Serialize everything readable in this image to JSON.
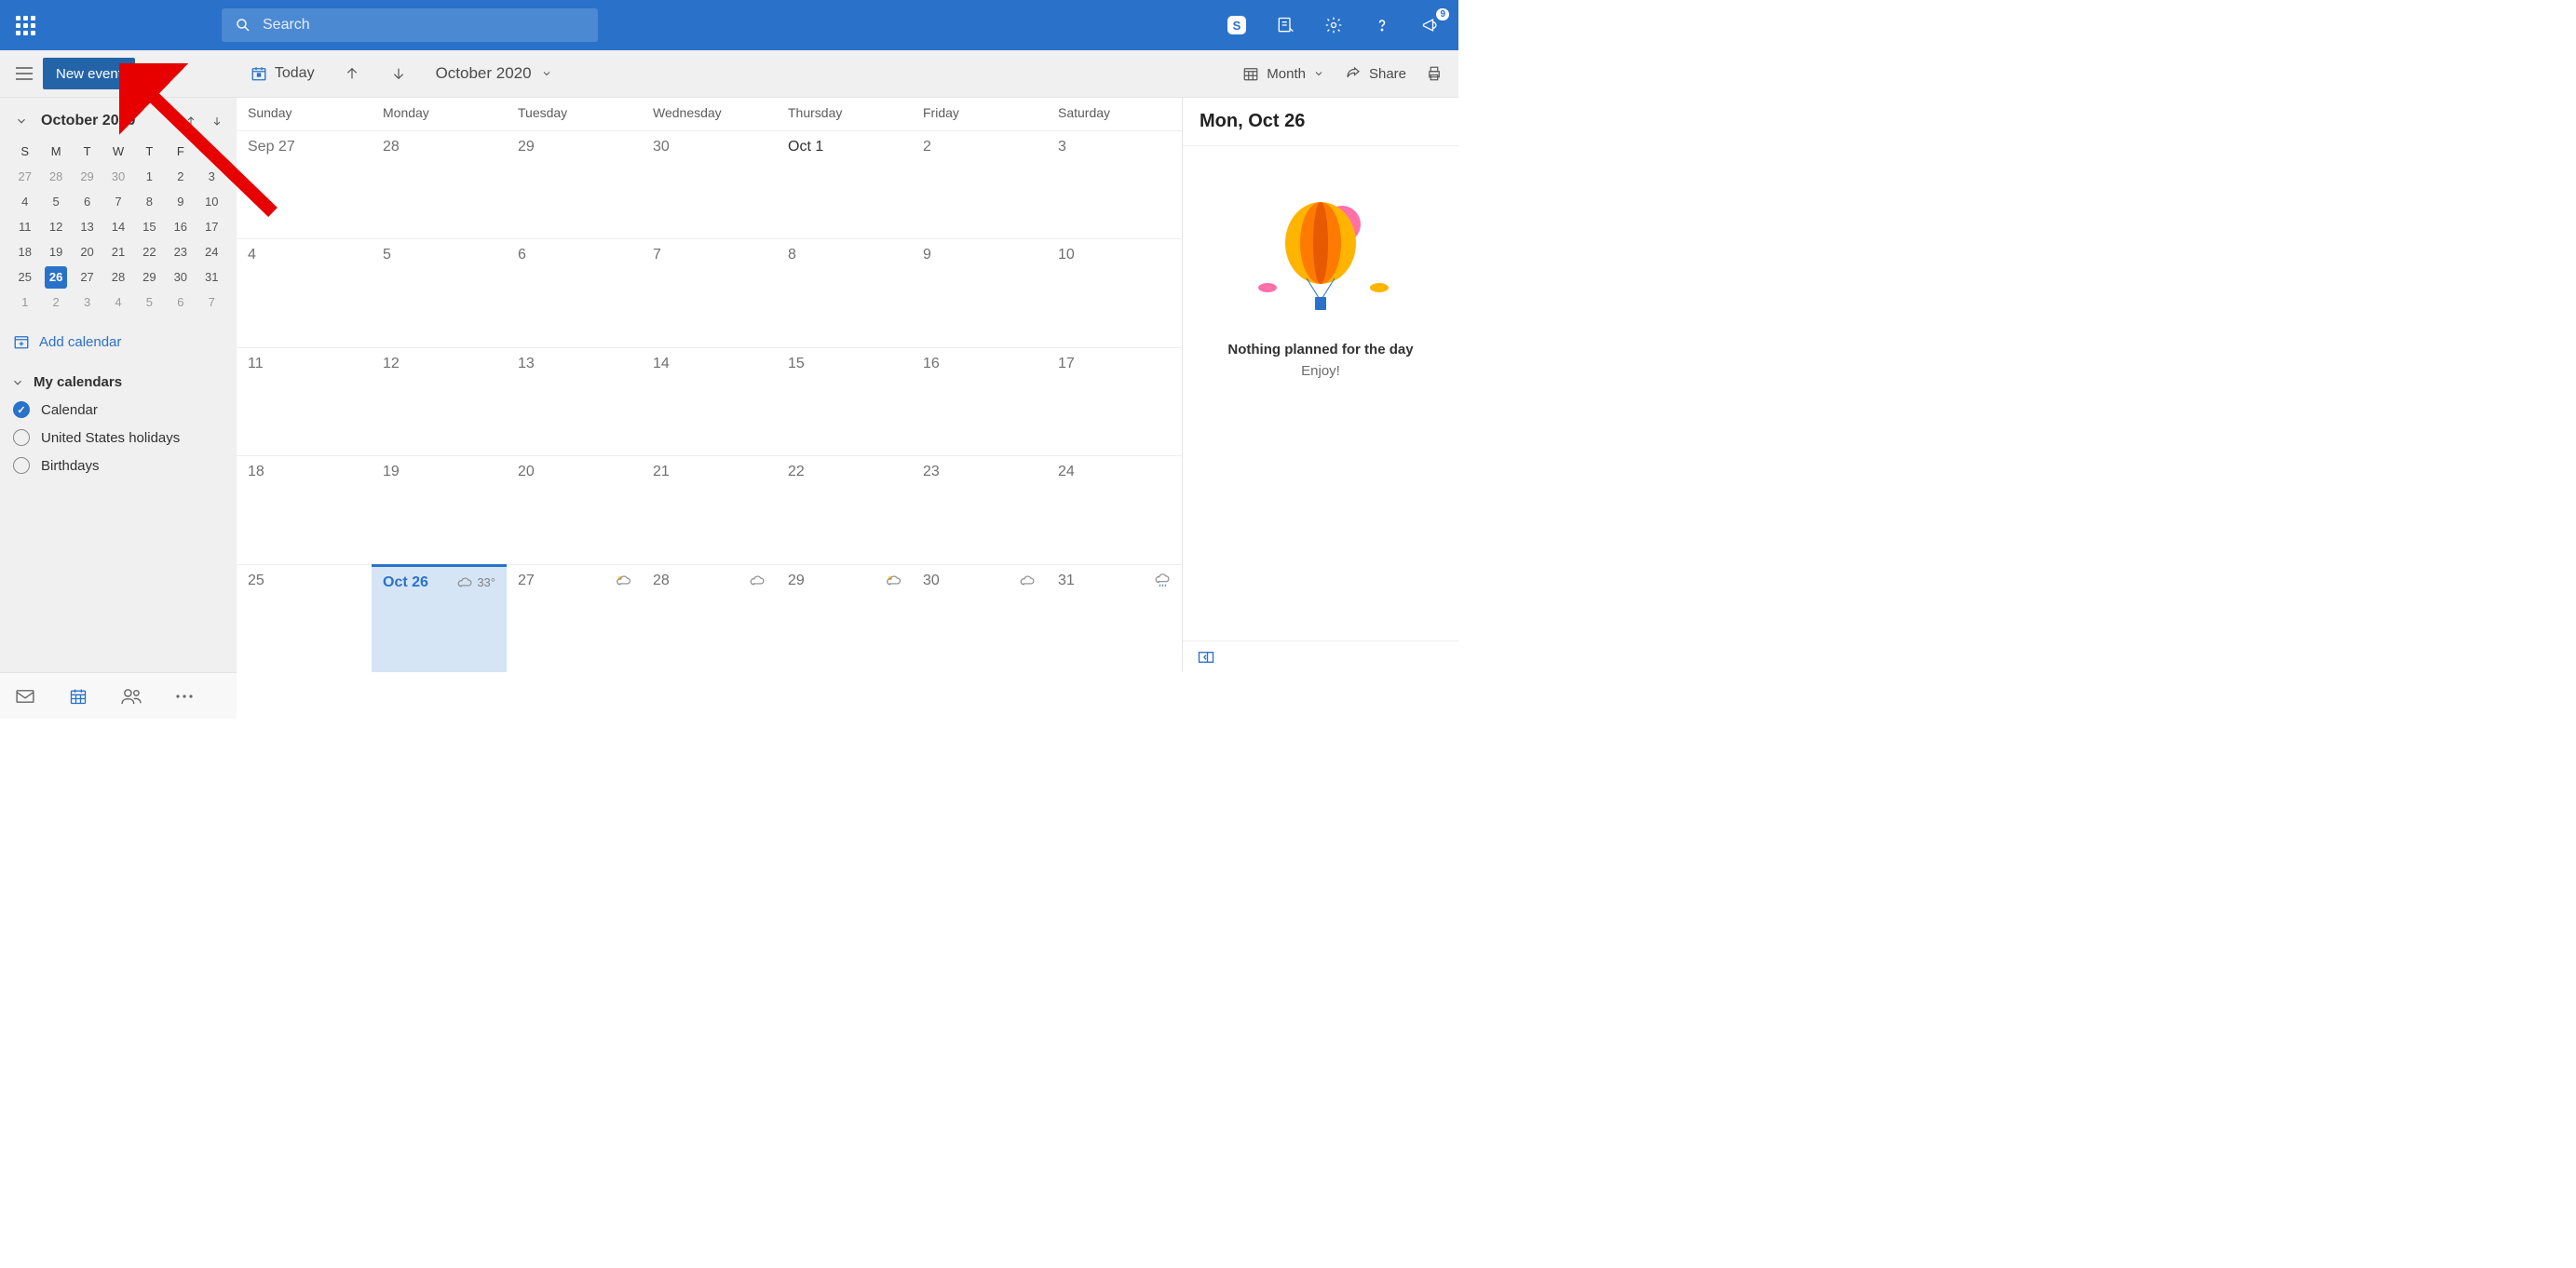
{
  "topbar": {
    "search_placeholder": "Search",
    "notification_count": "9",
    "skype_letter": "S"
  },
  "cmdbar": {
    "new_event": "New event",
    "today": "Today",
    "month_label": "October 2020",
    "view": "Month",
    "share": "Share"
  },
  "mini": {
    "title": "October 2020",
    "dow": [
      "S",
      "M",
      "T",
      "W",
      "T",
      "F",
      "S"
    ],
    "rows": [
      [
        {
          "d": "27",
          "dim": true
        },
        {
          "d": "28",
          "dim": true
        },
        {
          "d": "29",
          "dim": true
        },
        {
          "d": "30",
          "dim": true
        },
        {
          "d": "1"
        },
        {
          "d": "2"
        },
        {
          "d": "3"
        }
      ],
      [
        {
          "d": "4"
        },
        {
          "d": "5"
        },
        {
          "d": "6"
        },
        {
          "d": "7"
        },
        {
          "d": "8"
        },
        {
          "d": "9"
        },
        {
          "d": "10"
        }
      ],
      [
        {
          "d": "11"
        },
        {
          "d": "12"
        },
        {
          "d": "13"
        },
        {
          "d": "14"
        },
        {
          "d": "15"
        },
        {
          "d": "16"
        },
        {
          "d": "17"
        }
      ],
      [
        {
          "d": "18"
        },
        {
          "d": "19"
        },
        {
          "d": "20"
        },
        {
          "d": "21"
        },
        {
          "d": "22"
        },
        {
          "d": "23"
        },
        {
          "d": "24"
        }
      ],
      [
        {
          "d": "25"
        },
        {
          "d": "26",
          "today": true
        },
        {
          "d": "27"
        },
        {
          "d": "28"
        },
        {
          "d": "29"
        },
        {
          "d": "30"
        },
        {
          "d": "31"
        }
      ],
      [
        {
          "d": "1",
          "dim": true
        },
        {
          "d": "2",
          "dim": true
        },
        {
          "d": "3",
          "dim": true
        },
        {
          "d": "4",
          "dim": true
        },
        {
          "d": "5",
          "dim": true
        },
        {
          "d": "6",
          "dim": true
        },
        {
          "d": "7",
          "dim": true
        }
      ]
    ]
  },
  "add_calendar": "Add calendar",
  "my_calendars": "My calendars",
  "calendars": [
    {
      "name": "Calendar",
      "checked": true
    },
    {
      "name": "United States holidays",
      "checked": false
    },
    {
      "name": "Birthdays",
      "checked": false
    }
  ],
  "bigcal": {
    "dow": [
      "Sunday",
      "Monday",
      "Tuesday",
      "Wednesday",
      "Thursday",
      "Friday",
      "Saturday"
    ],
    "weeks": [
      [
        {
          "lbl": "Sep 27"
        },
        {
          "lbl": "28"
        },
        {
          "lbl": "29"
        },
        {
          "lbl": "30"
        },
        {
          "lbl": "Oct 1",
          "ms": true
        },
        {
          "lbl": "2"
        },
        {
          "lbl": "3"
        }
      ],
      [
        {
          "lbl": "4"
        },
        {
          "lbl": "5"
        },
        {
          "lbl": "6"
        },
        {
          "lbl": "7"
        },
        {
          "lbl": "8"
        },
        {
          "lbl": "9"
        },
        {
          "lbl": "10"
        }
      ],
      [
        {
          "lbl": "11"
        },
        {
          "lbl": "12"
        },
        {
          "lbl": "13"
        },
        {
          "lbl": "14"
        },
        {
          "lbl": "15"
        },
        {
          "lbl": "16"
        },
        {
          "lbl": "17"
        }
      ],
      [
        {
          "lbl": "18"
        },
        {
          "lbl": "19"
        },
        {
          "lbl": "20"
        },
        {
          "lbl": "21"
        },
        {
          "lbl": "22"
        },
        {
          "lbl": "23"
        },
        {
          "lbl": "24"
        }
      ],
      [
        {
          "lbl": "25"
        },
        {
          "lbl": "Oct 26",
          "today": true,
          "w": "33°",
          "wi": "cloud"
        },
        {
          "lbl": "27",
          "wi": "partly"
        },
        {
          "lbl": "28",
          "wi": "cloud"
        },
        {
          "lbl": "29",
          "wi": "partly"
        },
        {
          "lbl": "30",
          "wi": "cloud"
        },
        {
          "lbl": "31",
          "wi": "rain"
        }
      ]
    ]
  },
  "rightpane": {
    "title": "Mon, Oct 26",
    "msg": "Nothing planned for the day",
    "sub": "Enjoy!"
  }
}
